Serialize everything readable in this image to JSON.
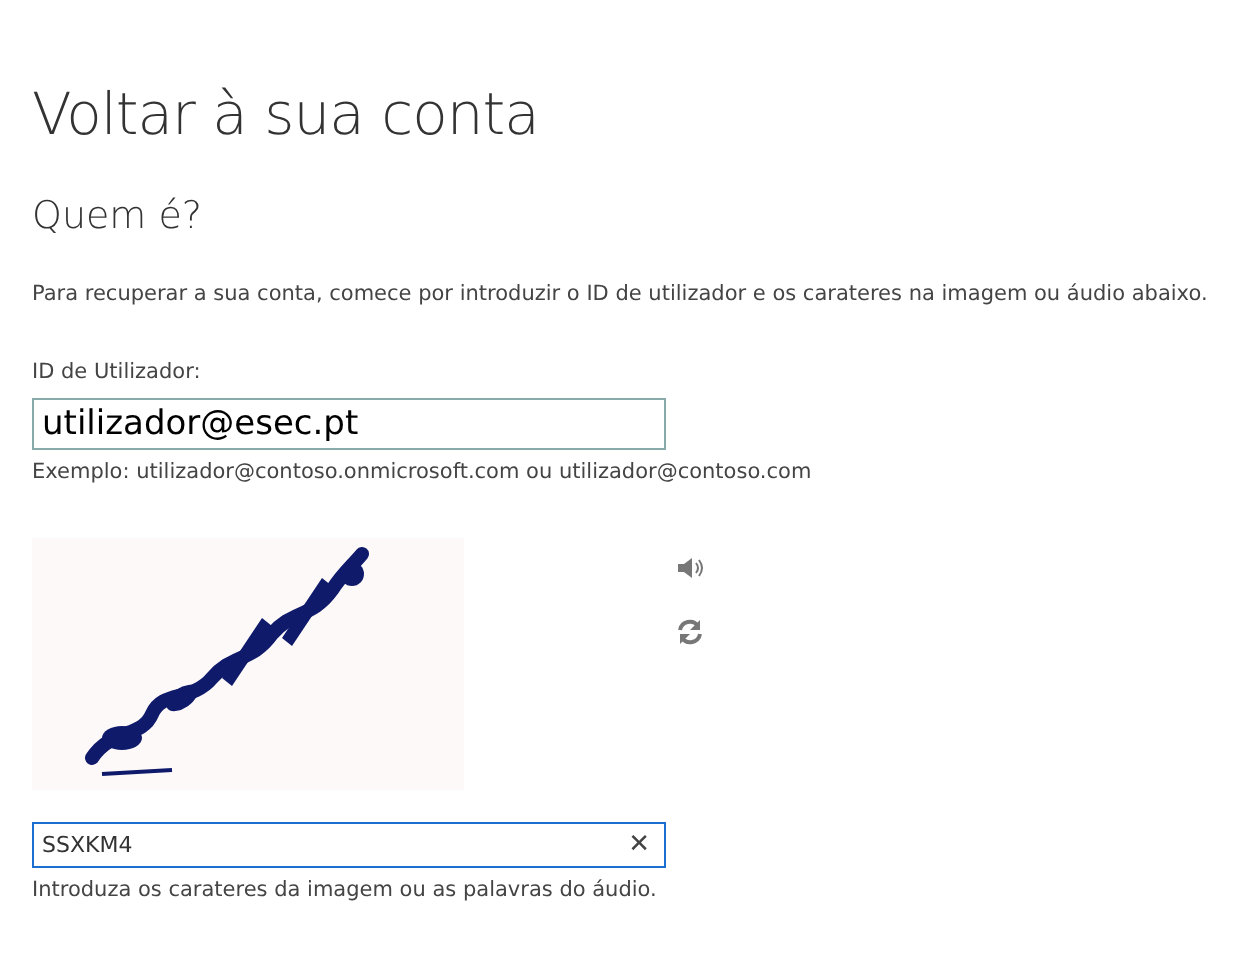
{
  "title": "Voltar à sua conta",
  "subtitle": "Quem é?",
  "intro": "Para recuperar a sua conta, comece por introduzir o ID de utilizador e os carateres na imagem ou áudio abaixo.",
  "user_id": {
    "label": "ID de Utilizador:",
    "value": "utilizador@esec.pt",
    "focused": false,
    "example": "Exemplo: utilizador@contoso.onmicrosoft.com ou utilizador@contoso.com"
  },
  "captcha": {
    "value": "SSXKM4",
    "focused": true,
    "clear": "✕",
    "hint": "Introduza os carateres da imagem ou as palavras do áudio."
  }
}
